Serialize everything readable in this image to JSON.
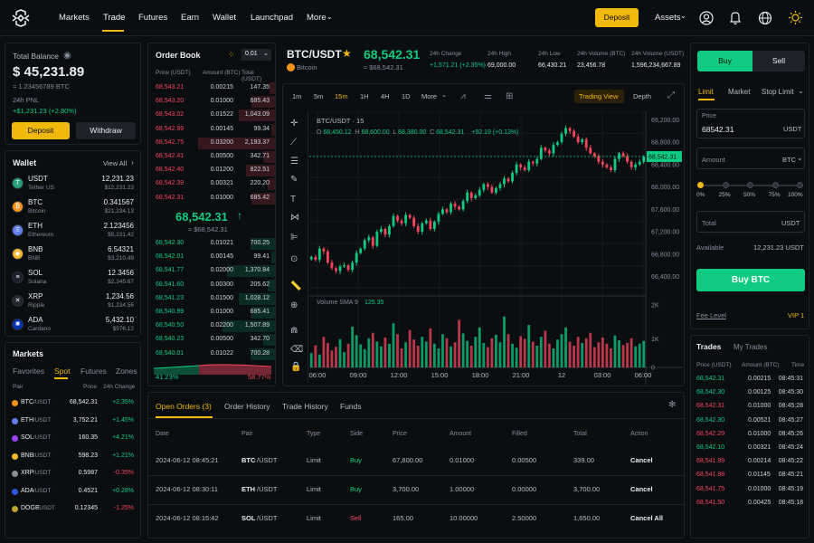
{
  "nav": {
    "links": [
      "Markets",
      "Trade",
      "Futures",
      "Earn",
      "Wallet",
      "Launchpad",
      "More"
    ],
    "deposit": "Deposit",
    "assets": "Assets"
  },
  "balance": {
    "title": "Total Balance",
    "usd": "$ 45,231.89",
    "btc": "≈ 1.23456789 BTC",
    "pnl_label": "24h PNL",
    "pnl_value": "+$1,231.23 (+2.80%)",
    "deposit": "Deposit",
    "withdraw": "Withdraw"
  },
  "wallet": {
    "title": "Wallet",
    "view_all": "View All",
    "items": [
      {
        "sym": "USDT",
        "name": "Tether US",
        "amount": "12,231.23",
        "usd": "$12,231.23",
        "color": "#26a17b",
        "glyph": "T"
      },
      {
        "sym": "BTC",
        "name": "Bitcoin",
        "amount": "0.341567",
        "usd": "$21,234.13",
        "color": "#f7931a",
        "glyph": "₿"
      },
      {
        "sym": "ETH",
        "name": "Ethereum",
        "amount": "2.123456",
        "usd": "$5,231.42",
        "color": "#627eea",
        "glyph": "Ξ"
      },
      {
        "sym": "BNB",
        "name": "BNB",
        "amount": "6.54321",
        "usd": "$3,210.49",
        "color": "#f3ba2f",
        "glyph": "◆"
      },
      {
        "sym": "SOL",
        "name": "Solana",
        "amount": "12.3456",
        "usd": "$2,345.67",
        "color": "#1e1e2e",
        "glyph": "≡"
      },
      {
        "sym": "XRP",
        "name": "Ripple",
        "amount": "1,234.56",
        "usd": "$1,234.56",
        "color": "#23292f",
        "glyph": "✕"
      },
      {
        "sym": "ADA",
        "name": "Cardano",
        "amount": "5,432.10",
        "usd": "$976.12",
        "color": "#0033ad",
        "glyph": "✺"
      }
    ]
  },
  "markets": {
    "title": "Markets",
    "tabs": [
      "Favorites",
      "Spot",
      "Futures",
      "Zones"
    ],
    "headers": [
      "Pair",
      "Price",
      "24h Change"
    ],
    "rows": [
      {
        "base": "BTC",
        "quote": "/USDT",
        "price": "68,542.31",
        "change": "+2.35%",
        "up": true,
        "color": "#f7931a"
      },
      {
        "base": "ETH",
        "quote": "/USDT",
        "price": "3,752.21",
        "change": "+1.45%",
        "up": true,
        "color": "#627eea"
      },
      {
        "base": "SOL",
        "quote": "/USDT",
        "price": "160.35",
        "change": "+4.21%",
        "up": true,
        "color": "#9945ff"
      },
      {
        "base": "BNB",
        "quote": "/USDT",
        "price": "598.23",
        "change": "+1.21%",
        "up": true,
        "color": "#f3ba2f"
      },
      {
        "base": "XRP",
        "quote": "/USDT",
        "price": "0.5987",
        "change": "-0.35%",
        "up": false,
        "color": "#8a8f98"
      },
      {
        "base": "ADA",
        "quote": "/USDT",
        "price": "0.4521",
        "change": "+0.28%",
        "up": true,
        "color": "#2a5ada"
      },
      {
        "base": "DOGE",
        "quote": "/USDT",
        "price": "0.12345",
        "change": "-1.25%",
        "up": false,
        "color": "#c2a633"
      }
    ]
  },
  "orderbook": {
    "title": "Order Book",
    "precision": "0.01",
    "headers": [
      "Price (USDT)",
      "Amount (BTC)",
      "Total (USDT)"
    ],
    "asks": [
      [
        "68,543.21",
        "0.00215",
        "147.35"
      ],
      [
        "68,543.20",
        "0.01000",
        "685.43"
      ],
      [
        "68,543.02",
        "0.01522",
        "1,043.09"
      ],
      [
        "68,542.99",
        "0.00145",
        "99.34"
      ],
      [
        "68,542.75",
        "0.03200",
        "2,193.37"
      ],
      [
        "68,542.41",
        "0.00500",
        "342.71"
      ],
      [
        "68,542.40",
        "0.01200",
        "822.51"
      ],
      [
        "68,542.39",
        "0.00321",
        "220.20"
      ],
      [
        "68,542.31",
        "0.01000",
        "685.42"
      ]
    ],
    "mid_price": "68,542.31",
    "mid_usd": "≈ $68,542.31",
    "bids": [
      [
        "68,542.30",
        "0.01021",
        "700.25"
      ],
      [
        "68,542.01",
        "0.00145",
        "99.41"
      ],
      [
        "68,541.77",
        "0.02000",
        "1,370.84"
      ],
      [
        "68,541.60",
        "0.00300",
        "205.62"
      ],
      [
        "68,541.23",
        "0.01500",
        "1,028.12"
      ],
      [
        "68,540.99",
        "0.01000",
        "685.41"
      ],
      [
        "68,540.50",
        "0.02200",
        "1,507.89"
      ],
      [
        "68,540.23",
        "0.00500",
        "342.70"
      ],
      [
        "68,540.01",
        "0.01022",
        "700.28"
      ]
    ],
    "buy_ratio": "41.23%",
    "sell_ratio": "58.77%"
  },
  "ticker": {
    "pair": "BTC/USDT",
    "name": "Bitcoin",
    "price": "68,542.31",
    "price_usd": "≈ $68,542.31",
    "stats": [
      {
        "label": "24h Change",
        "value": "+1,571.21 (+2.35%)",
        "up": true
      },
      {
        "label": "24h High",
        "value": "69,000.00"
      },
      {
        "label": "24h Low",
        "value": "66,430.21"
      },
      {
        "label": "24h Volume (BTC)",
        "value": "23,456.78"
      },
      {
        "label": "24h Volume (USDT)",
        "value": "1,596,234,667.89"
      }
    ]
  },
  "chart_toolbar": {
    "intervals": [
      "1m",
      "5m",
      "15m",
      "1H",
      "4H",
      "1D",
      "More"
    ],
    "active": "15m",
    "view": "Trading View",
    "depth": "Depth"
  },
  "chart_data": {
    "type": "candlestick",
    "title": "BTC/USDT · 15",
    "ohlc": {
      "o": "68,450.12",
      "h": "68,600.00",
      "l": "68,380.00",
      "c": "68,542.31",
      "chg": "+92.19 (+0.13%)"
    },
    "y_ticks": [
      "69,200.00",
      "68,800.00",
      "68,400.00",
      "68,000.00",
      "67,600.00",
      "67,200.00",
      "66,800.00",
      "66,400.00"
    ],
    "ylim": [
      66200,
      69350
    ],
    "last_price": "68,542.31",
    "last_value": 68542,
    "x_ticks": [
      "06:00",
      "09:00",
      "12:00",
      "15:00",
      "18:00",
      "21:00",
      "12",
      "03:00",
      "06:00"
    ],
    "volume_label": "Volume SMA 9",
    "volume_value": "125.35",
    "volume_ticks": [
      "2K",
      "1K",
      "0"
    ],
    "closes": [
      66750,
      66700,
      66900,
      66850,
      66650,
      66550,
      66500,
      66580,
      66600,
      66520,
      66650,
      66820,
      66900,
      67050,
      67100,
      66950,
      67200,
      67250,
      67150,
      67300,
      67480,
      67400,
      67350,
      67500,
      67450,
      67300,
      67200,
      67350,
      67400,
      67250,
      67380,
      67520,
      67600,
      67550,
      67700,
      67650,
      67600,
      67750,
      67900,
      67800,
      67850,
      67950,
      68050,
      68000,
      67900,
      67980,
      68050,
      68150,
      68100,
      68250,
      68400,
      68350,
      68300,
      68450,
      68420,
      68500,
      68700,
      68650,
      68600,
      68750,
      68800,
      68950,
      69050,
      69000,
      68900,
      68800,
      68850,
      68700,
      68600,
      68550,
      68450,
      68400,
      68350,
      68300,
      68500,
      68600,
      68550,
      68450,
      68350,
      68400,
      68450,
      68542
    ],
    "volumes": [
      420,
      650,
      380,
      900,
      720,
      500,
      610,
      830,
      450,
      700,
      1200,
      950,
      680,
      540,
      860,
      1020,
      760,
      620,
      880,
      700,
      1300,
      980,
      560,
      740,
      1100,
      820,
      640,
      900,
      760,
      1150,
      700,
      560,
      980,
      860,
      620,
      740,
      1400,
      1000,
      780,
      640,
      900,
      1180,
      720,
      600,
      860,
      960,
      740,
      1500,
      980,
      700,
      580,
      920,
      840,
      1250,
      760,
      640,
      900,
      1080,
      700,
      560,
      820,
      980,
      1180,
      760,
      640,
      900,
      720,
      860,
      1020,
      600,
      740,
      880,
      700,
      560,
      940,
      800,
      660,
      720,
      860,
      620,
      700,
      780
    ]
  },
  "orders": {
    "tabs": [
      "Open Orders (3)",
      "Order History",
      "Trade History",
      "Funds"
    ],
    "headers": [
      "Date",
      "Pair",
      "Type",
      "Side",
      "Price",
      "Amount",
      "Filled",
      "Total",
      "Action"
    ],
    "rows": [
      {
        "date": "2024-06-12 08:45:21",
        "base": "BTC",
        "quote": "/USDT",
        "type": "Limit",
        "side": "Buy",
        "price": "67,800.00",
        "amount": "0.01000",
        "filled": "0.00500",
        "total": "339.00",
        "action": "Cancel"
      },
      {
        "date": "2024-06-12 08:30:11",
        "base": "ETH",
        "quote": "/USDT",
        "type": "Limit",
        "side": "Buy",
        "price": "3,700.00",
        "amount": "1.00000",
        "filled": "0.00000",
        "total": "3,700.00",
        "action": "Cancel"
      },
      {
        "date": "2024-06-12 08:15:42",
        "base": "SOL",
        "quote": "/USDT",
        "type": "Limit",
        "side": "Sell",
        "price": "165.00",
        "amount": "10.00000",
        "filled": "2.50000",
        "total": "1,650.00",
        "action": "Cancel All"
      }
    ]
  },
  "trade_form": {
    "buy_tab": "Buy",
    "sell_tab": "Sell",
    "order_types": [
      "Limit",
      "Market",
      "Stop Limit"
    ],
    "price_label": "Price",
    "price_value": "68542.31",
    "price_unit": "USDT",
    "amount_label": "Amount",
    "amount_unit": "BTC",
    "slider_marks": [
      "0%",
      "25%",
      "50%",
      "75%",
      "100%"
    ],
    "slider_fraction": 0,
    "total_label": "Total",
    "total_unit": "USDT",
    "available_label": "Available",
    "available_value": "12,231.23 USDT",
    "submit": "Buy BTC",
    "fee_label": "Fee Level",
    "fee_value": "VIP 1"
  },
  "trades": {
    "tabs": [
      "Trades",
      "My Trades"
    ],
    "headers": [
      "Price (USDT)",
      "Amount (BTC)",
      "Time"
    ],
    "rows": [
      {
        "price": "68,542.31",
        "amount": "0.00215",
        "time": "08:45:31",
        "up": true
      },
      {
        "price": "68,542.30",
        "amount": "0.00125",
        "time": "08:45:30",
        "up": true
      },
      {
        "price": "68,542.31",
        "amount": "0.01000",
        "time": "08:45:28",
        "up": false
      },
      {
        "price": "68,542.30",
        "amount": "0.00521",
        "time": "08:45:27",
        "up": true
      },
      {
        "price": "68,542.29",
        "amount": "0.01000",
        "time": "08:45:26",
        "up": false
      },
      {
        "price": "68,542.10",
        "amount": "0.00321",
        "time": "08:45:24",
        "up": true
      },
      {
        "price": "68,541.99",
        "amount": "0.00214",
        "time": "08:45:22",
        "up": false
      },
      {
        "price": "68,541.98",
        "amount": "0.01145",
        "time": "08:45:21",
        "up": false
      },
      {
        "price": "68,541.75",
        "amount": "0.01000",
        "time": "08:45:19",
        "up": false
      },
      {
        "price": "68,541.50",
        "amount": "0.00425",
        "time": "08:45:18",
        "up": false
      }
    ]
  },
  "colors": {
    "accent": "#f0b90b",
    "up": "#0ecb81",
    "down": "#f6465d",
    "muted": "#848e9c",
    "bg": "#0b0e11",
    "panel_border": "#1e2329"
  }
}
